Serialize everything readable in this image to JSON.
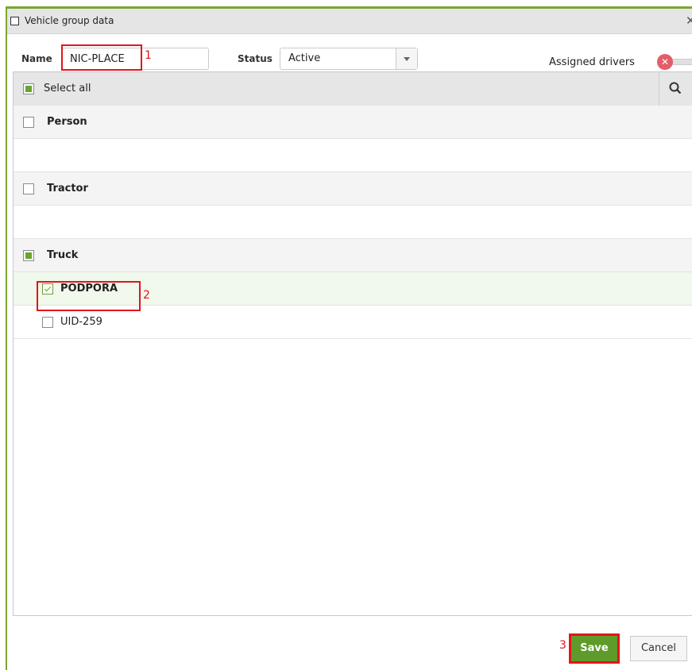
{
  "window": {
    "title": "Vehicle group data",
    "close_symbol": "✕"
  },
  "form": {
    "name_label": "Name",
    "name_value": "NIC-PLACE",
    "status_label": "Status",
    "status_value": "Active",
    "assigned_drivers_label": "Assigned drivers",
    "assigned_drivers_enabled": false,
    "toggle_symbol": "✕"
  },
  "list": {
    "select_all_label": "Select all",
    "groups": [
      {
        "label": "Person",
        "state": "unchecked",
        "items": []
      },
      {
        "label": "Tractor",
        "state": "unchecked",
        "items": []
      },
      {
        "label": "Truck",
        "state": "partial",
        "items": [
          {
            "label": "PODPORA",
            "checked": true
          },
          {
            "label": "UID-259",
            "checked": false
          }
        ]
      }
    ]
  },
  "annotations": [
    "1",
    "2",
    "3"
  ],
  "buttons": {
    "save_label": "Save",
    "cancel_label": "Cancel"
  },
  "colors": {
    "accent_green": "#5e9b2a",
    "annotation_red": "#e3141b",
    "toggle_off_red": "#e35d6a"
  },
  "icons": {
    "window": "square-icon",
    "close": "close-icon",
    "search": "search-icon",
    "dropdown": "chevron-down-icon",
    "toggle": "toggle-off-icon"
  }
}
